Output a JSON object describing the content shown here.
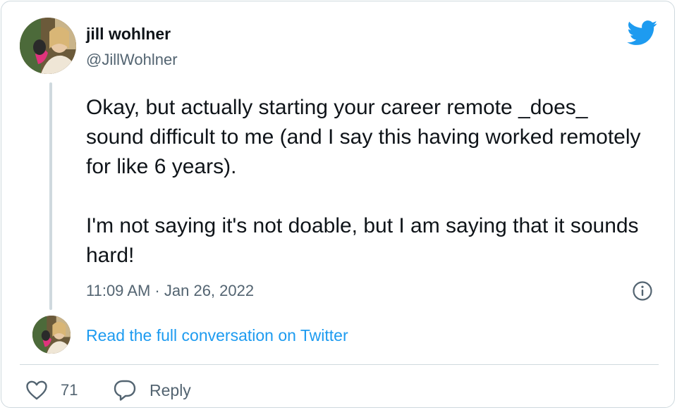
{
  "author": {
    "name": "jill wohlner",
    "handle": "@JillWohlner"
  },
  "tweet": {
    "paragraphs": [
      "Okay, but actually starting your career remote _does_ sound difficult to me (and I say this having worked remotely for like 6 years).",
      "I'm not saying it's not doable, but I am saying that it sounds hard!"
    ],
    "timestamp": "11:09 AM · Jan 26, 2022"
  },
  "conversation": {
    "link_text": "Read the full conversation on Twitter"
  },
  "actions": {
    "like_count": "71",
    "reply_label": "Reply"
  },
  "icons": {
    "brand": "twitter-bird-icon",
    "info": "info-icon",
    "like": "heart-icon",
    "reply": "speech-bubble-icon"
  },
  "colors": {
    "brand_blue": "#1d9bf0",
    "text_primary": "#0f1419",
    "text_secondary": "#536471",
    "border": "#cfd9de"
  }
}
